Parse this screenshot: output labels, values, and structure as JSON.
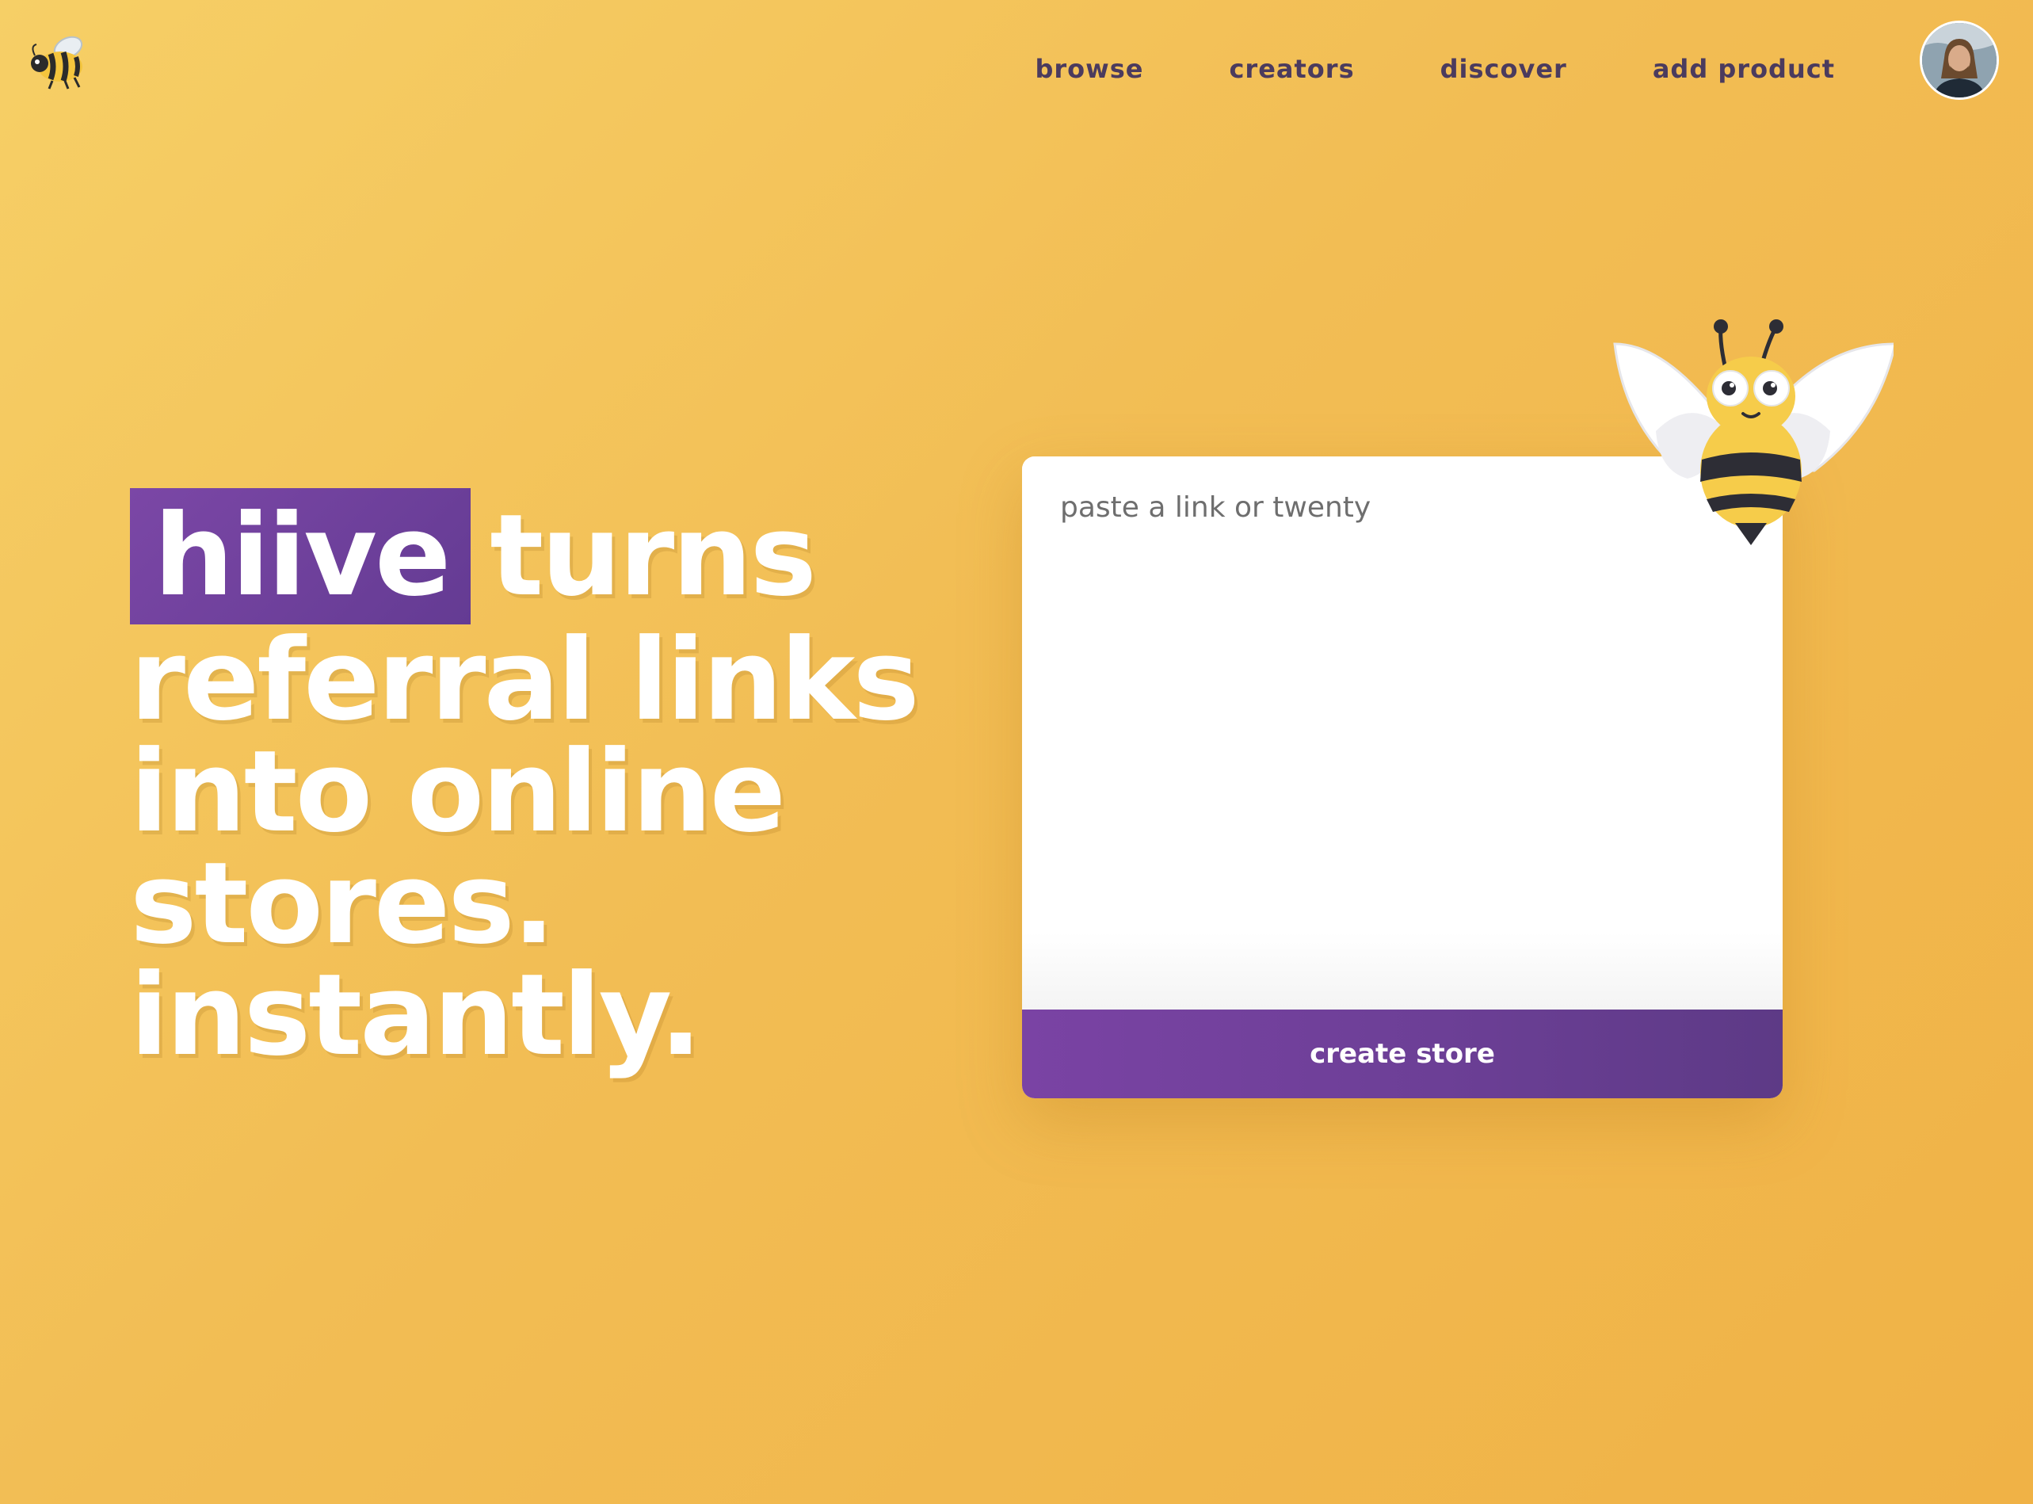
{
  "logo": {
    "icon": "bee-emoji-icon"
  },
  "nav": {
    "items": [
      {
        "label": "browse"
      },
      {
        "label": "creators"
      },
      {
        "label": "discover"
      },
      {
        "label": "add product"
      }
    ],
    "avatar_icon": "user-avatar-icon"
  },
  "hero": {
    "brand": "hiive",
    "line1_rest": "turns",
    "line2": "referral links",
    "line3": "into online",
    "line4": "stores.",
    "line5": "instantly."
  },
  "form": {
    "placeholder": "paste a link or twenty",
    "submit_label": "create store"
  },
  "colors": {
    "background": "#f2bd54",
    "brand_purple": "#6c3f96",
    "nav_text": "#4b3b5e",
    "card": "#ffffff"
  },
  "mascot": {
    "icon": "bee-mascot-icon"
  }
}
